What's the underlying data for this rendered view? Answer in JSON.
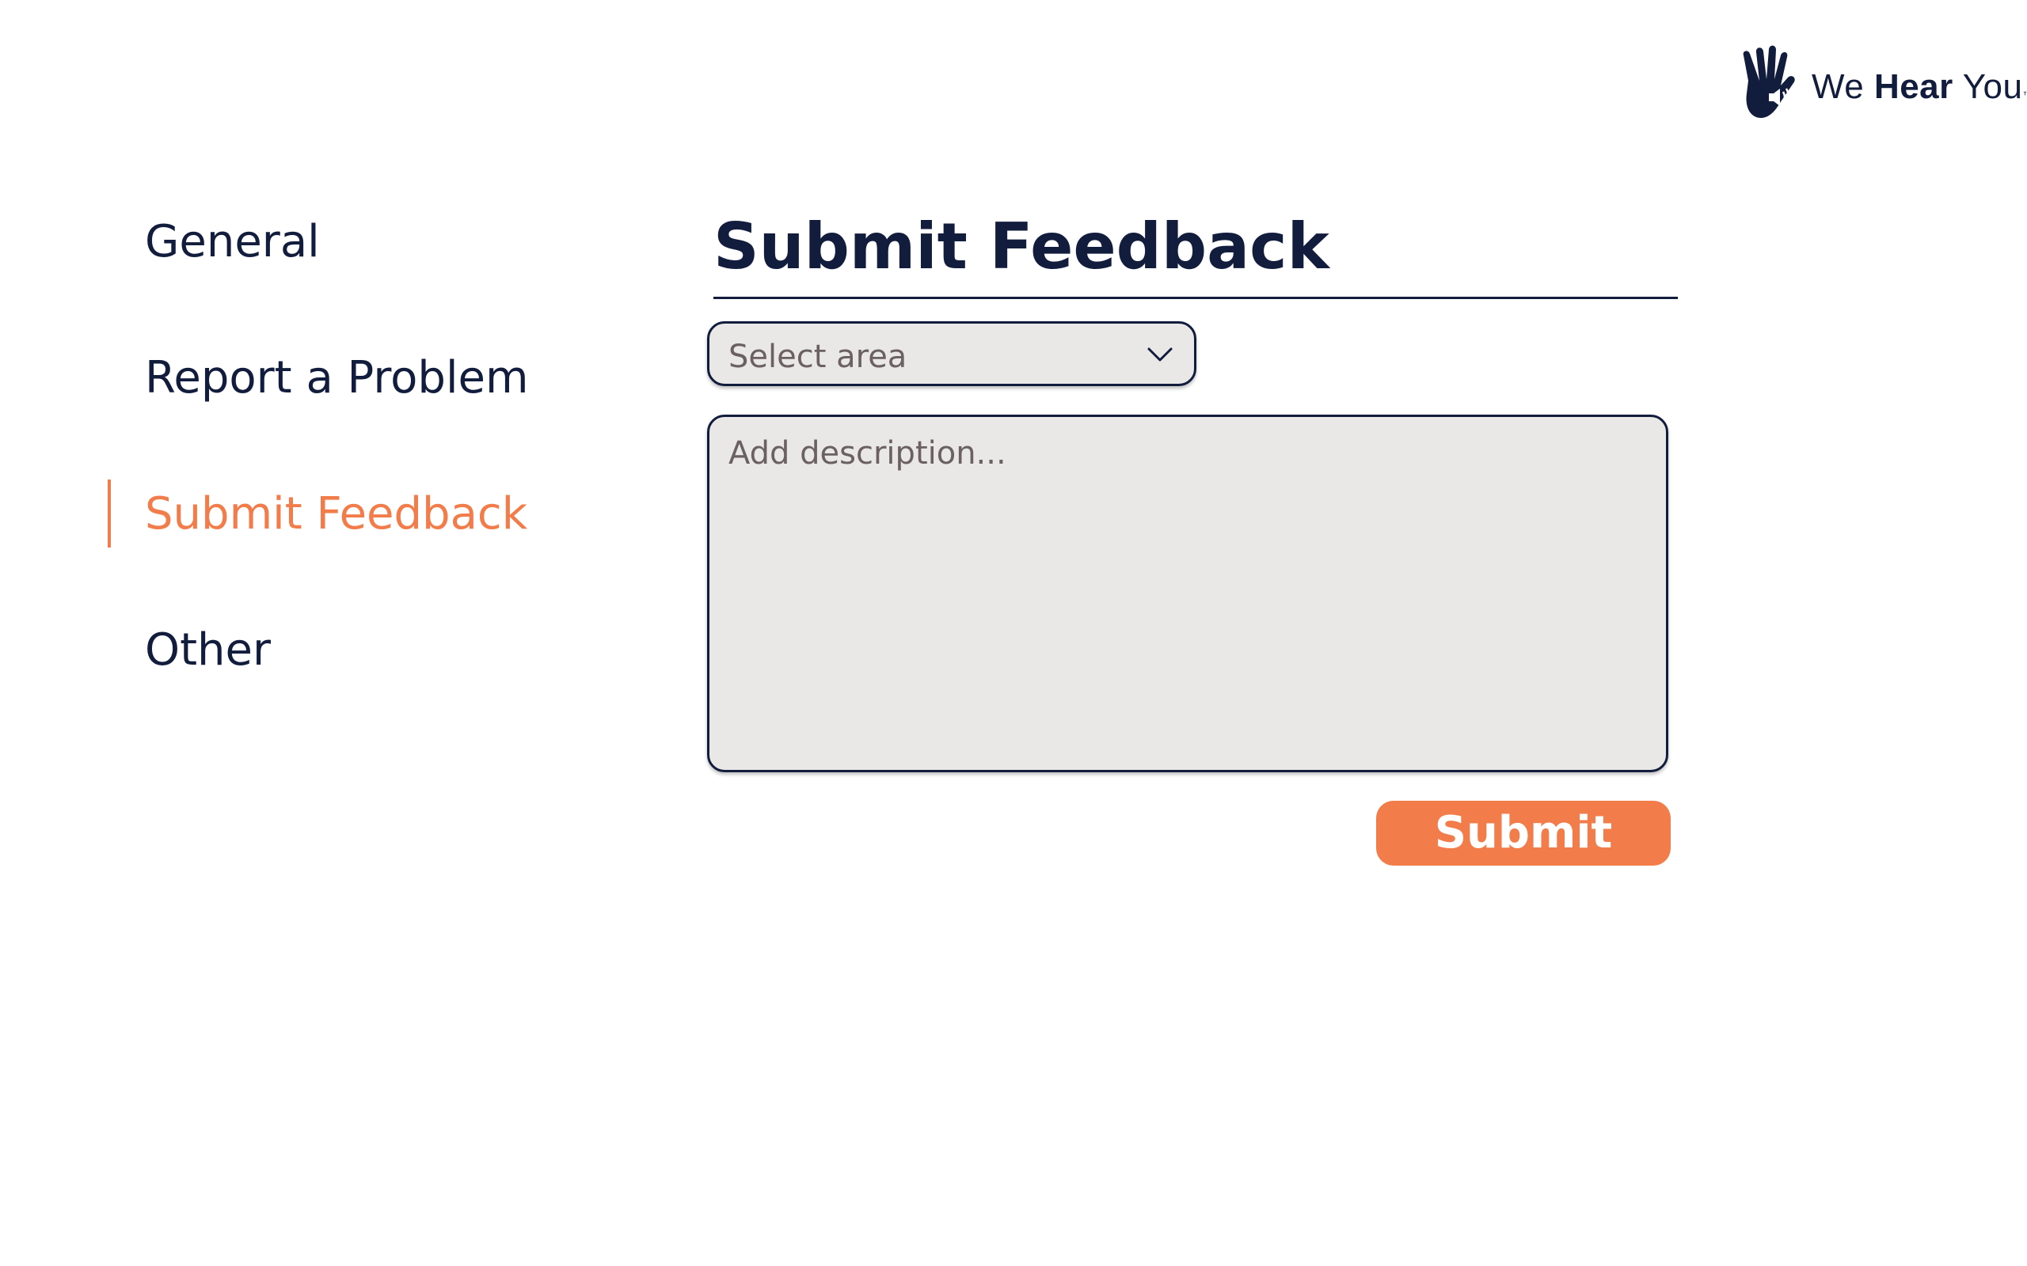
{
  "brand": {
    "logo_icon": "hand-speaker-icon",
    "name_part1": "We ",
    "name_part2": "Hear",
    "name_part3": " You",
    "trademark": "™",
    "primary_color": "#121c3d",
    "accent_color": "#f27c4a"
  },
  "sidebar": {
    "items": [
      {
        "label": "General",
        "active": false
      },
      {
        "label": "Report a Problem",
        "active": false
      },
      {
        "label": "Submit Feedback",
        "active": true
      },
      {
        "label": "Other",
        "active": false
      }
    ]
  },
  "form": {
    "title": "Submit Feedback",
    "area_select": {
      "value": "Select area",
      "icon": "chevron-down-icon"
    },
    "description": {
      "placeholder": "Add description...",
      "value": ""
    },
    "submit_label": "Submit"
  }
}
